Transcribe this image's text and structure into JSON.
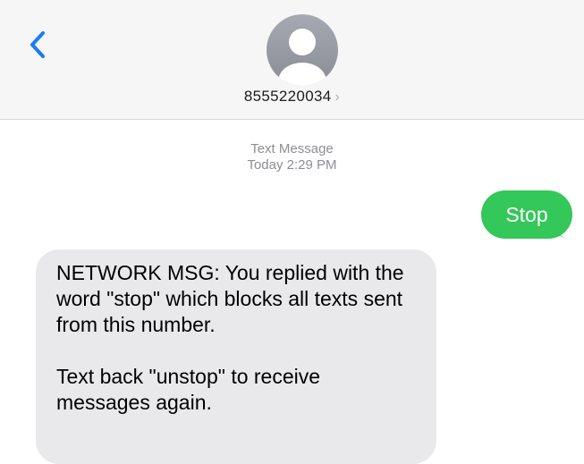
{
  "header": {
    "contact_number": "8555220034",
    "chevron": "›",
    "back_icon": "chevron-left-icon",
    "avatar_icon": "person-silhouette-icon"
  },
  "conversation": {
    "service_label": "Text Message",
    "time_label": "Today 2:29 PM",
    "messages": [
      {
        "direction": "outgoing",
        "text": "Stop"
      },
      {
        "direction": "incoming",
        "paragraphs": [
          "NETWORK MSG: You replied with the word \"stop\" which blocks all texts sent from this number.",
          "Text back \"unstop\" to receive messages again."
        ]
      }
    ]
  },
  "colors": {
    "accent_blue": "#1a7cf5",
    "outgoing_bubble": "#34c759",
    "incoming_bubble": "#e9e9eb",
    "header_bg": "#f6f6f6"
  }
}
